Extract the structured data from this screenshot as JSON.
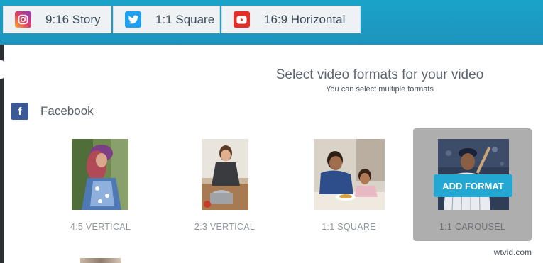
{
  "format_tabs": [
    {
      "label": "9:16 Story",
      "icon": "instagram-icon"
    },
    {
      "label": "1:1 Square",
      "icon": "twitter-icon"
    },
    {
      "label": "16:9 Horizontal",
      "icon": "youtube-icon"
    }
  ],
  "header": {
    "title": "Select video formats for your video",
    "subtitle": "You can select multiple formats"
  },
  "section": {
    "label": "Facebook",
    "icon": "facebook-icon"
  },
  "cards": [
    {
      "caption": "4:5 VERTICAL"
    },
    {
      "caption": "2:3 VERTICAL"
    },
    {
      "caption": "1:1 SQUARE"
    },
    {
      "caption": "1:1 CAROUSEL",
      "button": "ADD FORMAT"
    }
  ],
  "watermark": "wtvid.com",
  "colors": {
    "top_bar": "#1e9fc8",
    "accent": "#23a7d3",
    "facebook": "#3b5998",
    "card_hover": "#aeaeae"
  }
}
